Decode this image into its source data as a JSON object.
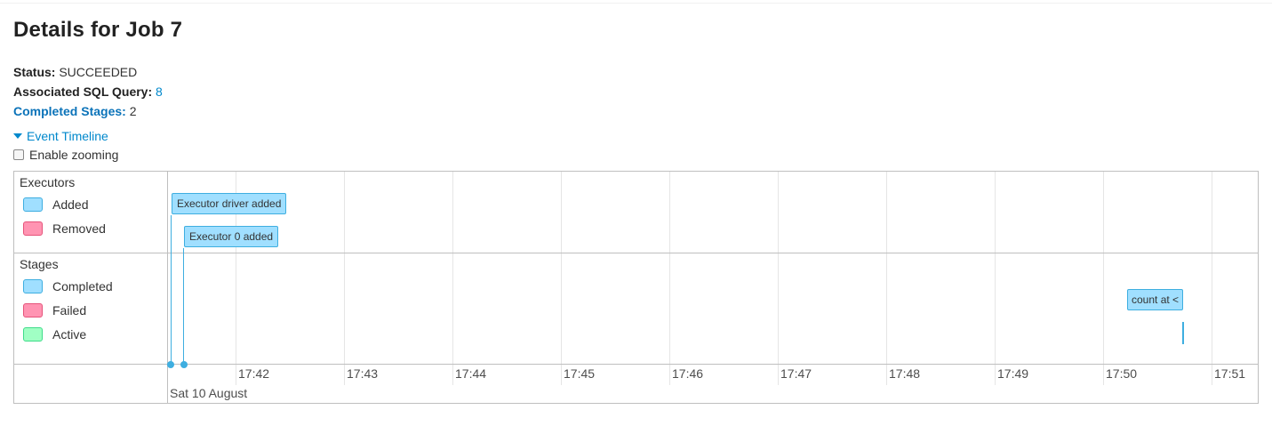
{
  "title": "Details for Job 7",
  "status": {
    "label": "Status:",
    "value": "SUCCEEDED"
  },
  "sql_query": {
    "label": "Associated SQL Query:",
    "value": "8"
  },
  "completed_stages": {
    "label": "Completed Stages:",
    "value": "2"
  },
  "event_timeline": {
    "label": "Event Timeline"
  },
  "zoom": {
    "label": "Enable zooming"
  },
  "timeline": {
    "executors": {
      "title": "Executors",
      "legend": [
        {
          "label": "Added",
          "color": "#a0dfff",
          "border": "#3eaee0"
        },
        {
          "label": "Removed",
          "color": "#ff94b2",
          "border": "#e6537a"
        }
      ],
      "events": [
        "Executor driver added",
        "Executor 0 added"
      ]
    },
    "stages": {
      "title": "Stages",
      "legend": [
        {
          "label": "Completed",
          "color": "#a0dfff",
          "border": "#3eaee0"
        },
        {
          "label": "Failed",
          "color": "#ff94b2",
          "border": "#e6537a"
        },
        {
          "label": "Active",
          "color": "#a0ffc4",
          "border": "#3fdc8a"
        }
      ],
      "events": [
        "count at <"
      ]
    },
    "axis": {
      "ticks": [
        "17:42",
        "17:43",
        "17:44",
        "17:45",
        "17:46",
        "17:47",
        "17:48",
        "17:49",
        "17:50",
        "17:51"
      ],
      "date": "Sat 10 August"
    }
  }
}
